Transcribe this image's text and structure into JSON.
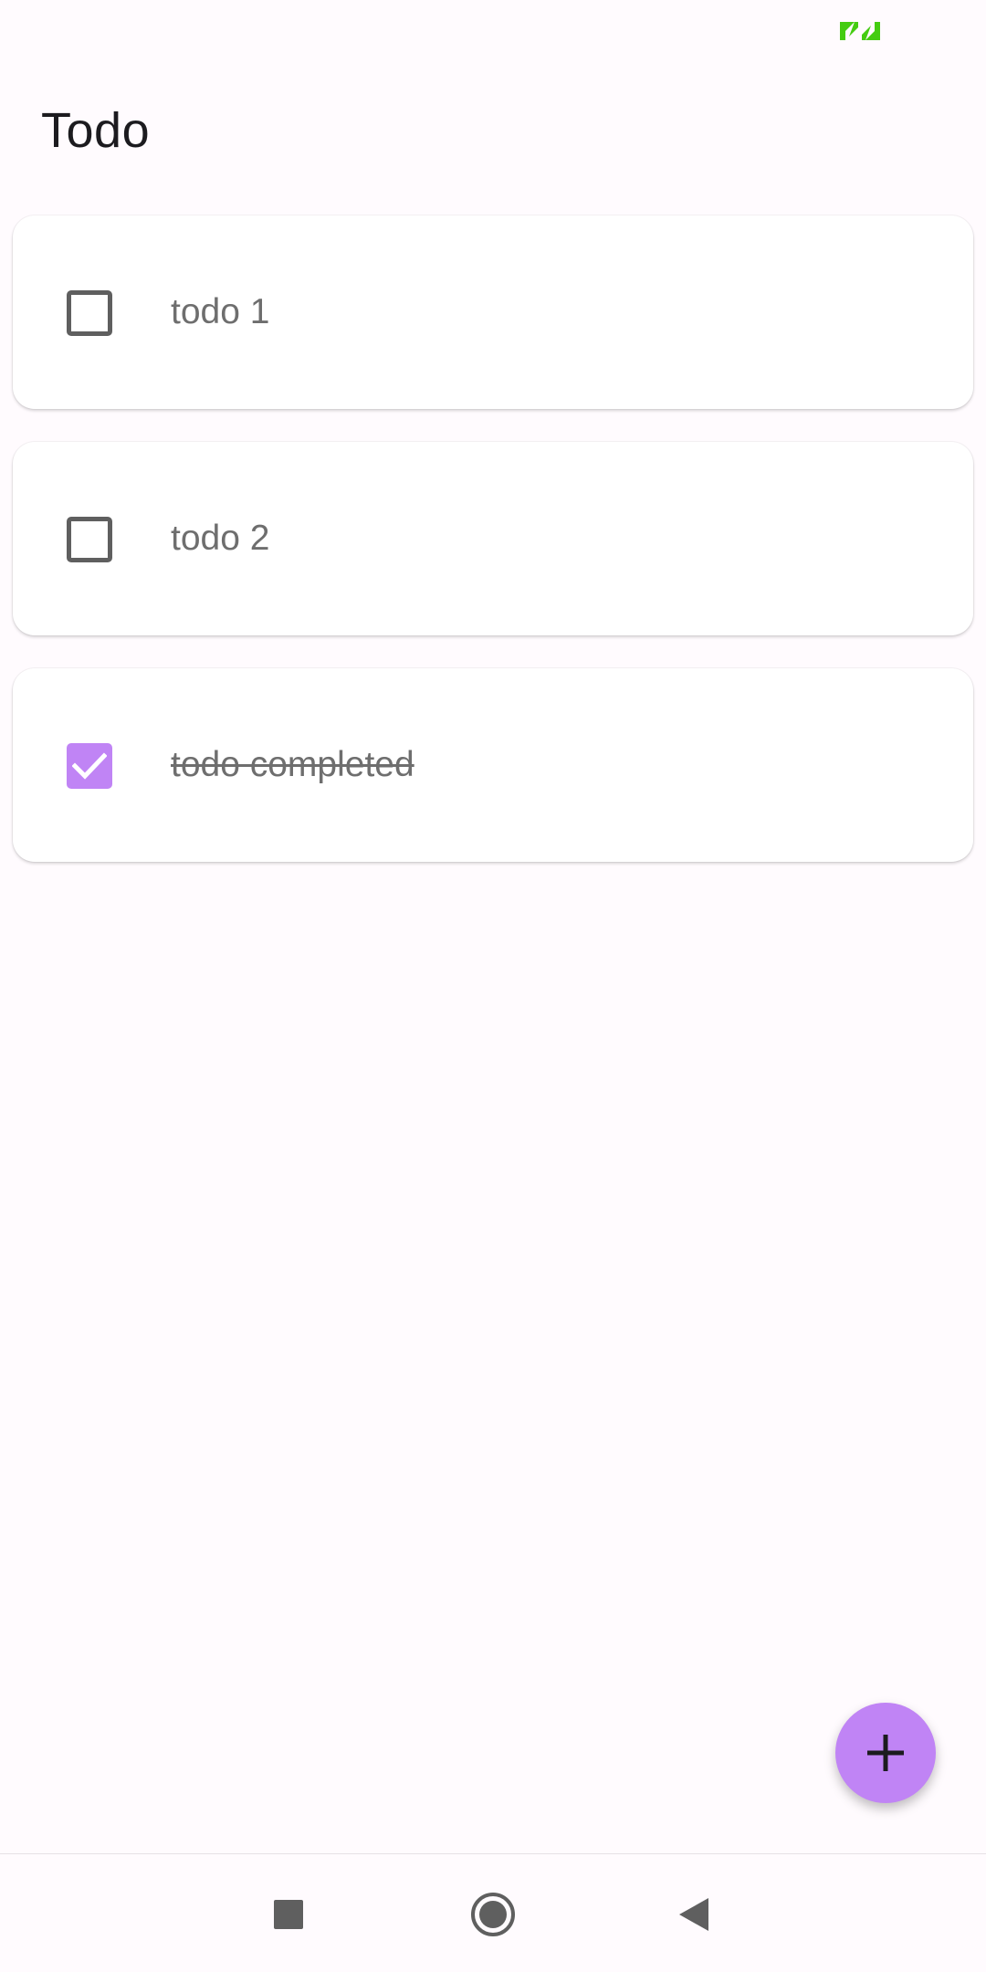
{
  "status_bar": {
    "icon": "battery-charging-icon",
    "icon_color": "#44cc11"
  },
  "app": {
    "title": "Todo",
    "accent_color": "#c084f5"
  },
  "todos": [
    {
      "label": "todo 1",
      "completed": false
    },
    {
      "label": "todo 2",
      "completed": false
    },
    {
      "label": "todo completed",
      "completed": true
    }
  ],
  "fab": {
    "icon": "plus-icon"
  },
  "nav_bar": {
    "recents_icon": "square-icon",
    "home_icon": "circle-icon",
    "back_icon": "triangle-back-icon"
  }
}
